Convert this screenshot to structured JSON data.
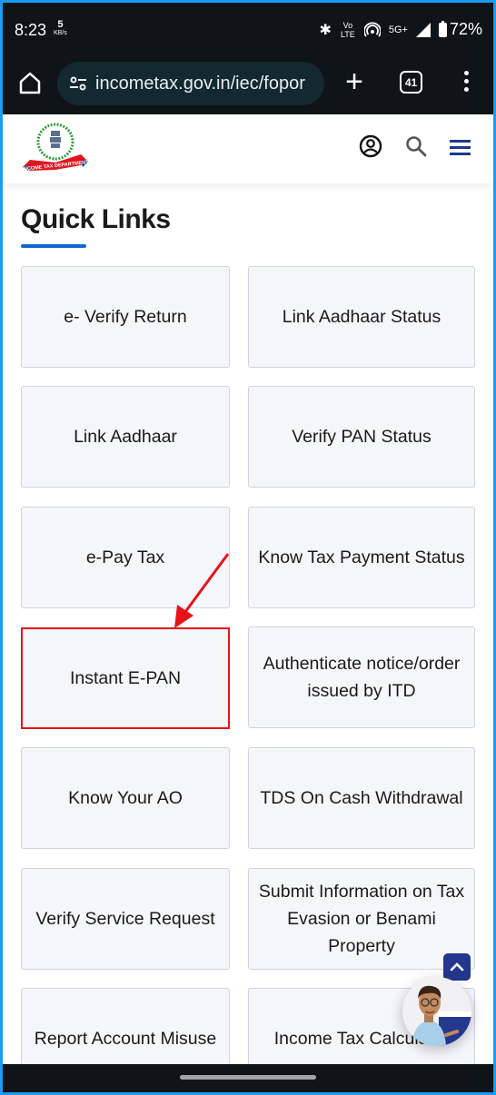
{
  "status_bar": {
    "time": "8:23",
    "net_speed_value": "5",
    "net_speed_unit": "KB/s",
    "volte_label": "Vo LTE",
    "network_label": "5G+",
    "battery": "72%"
  },
  "browser": {
    "url": "incometax.gov.in/iec/fopor",
    "tab_count": "41"
  },
  "site_header": {
    "logo_text": "INCOME TAX DEPARTMENT"
  },
  "page": {
    "title": "Quick Links",
    "quick_links": [
      {
        "label": "e- Verify Return"
      },
      {
        "label": "Link Aadhaar Status"
      },
      {
        "label": "Link Aadhaar"
      },
      {
        "label": "Verify PAN Status"
      },
      {
        "label": "e-Pay Tax"
      },
      {
        "label": "Know Tax Payment Status"
      },
      {
        "label": "Instant E-PAN"
      },
      {
        "label": "Authenticate notice/order issued by ITD"
      },
      {
        "label": "Know Your AO"
      },
      {
        "label": "TDS On Cash Withdrawal"
      },
      {
        "label": "Verify Service Request"
      },
      {
        "label": "Submit Information on Tax Evasion or Benami Property"
      },
      {
        "label": "Report Account Misuse"
      },
      {
        "label": "Income Tax Calculator"
      }
    ]
  },
  "colors": {
    "accent_blue": "#1066d2",
    "highlight_red": "#e8121b",
    "nav_blue": "#24378f"
  }
}
